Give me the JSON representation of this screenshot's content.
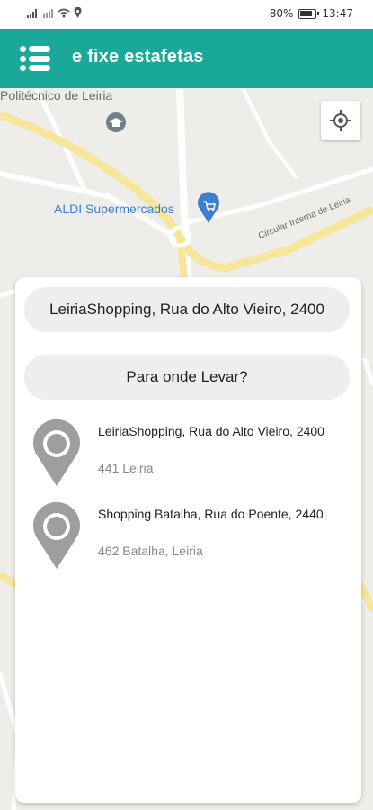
{
  "status_bar": {
    "battery_percent": "80%",
    "time": "13:47"
  },
  "app_bar": {
    "title": "e fixe estafetas"
  },
  "map": {
    "labels": {
      "politecnico": "Politécnico de Leiria",
      "aldi": "ALDI Supermercados",
      "circular": "Circular Interna de Leiria"
    }
  },
  "search": {
    "origin_value": "LeiriaShopping, Rua do Alto Vieiro, 2400",
    "destination_placeholder": "Para onde Levar?"
  },
  "results": [
    {
      "line1": "LeiriaShopping, Rua do Alto Vieiro, 2400",
      "line2": "441 Leiria"
    },
    {
      "line1": "Shopping Batalha, Rua do Poente, 2440",
      "line2": "462 Batalha, Leiria"
    }
  ],
  "colors": {
    "app_bar": "#1aa898",
    "pin": "#9e9e9e",
    "road_major": "#f6e69a",
    "map_bg": "#efede9"
  }
}
